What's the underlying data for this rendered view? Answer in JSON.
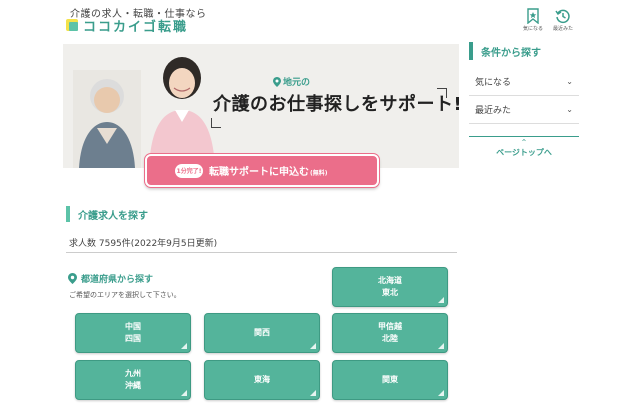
{
  "header": {
    "tagline": "介護の求人・転職・仕事なら",
    "logo_text": "ココカイゴ転職",
    "icons": [
      {
        "icon": "bookmark-star-icon",
        "label": "気になる"
      },
      {
        "icon": "history-clock-icon",
        "label": "最近みた"
      }
    ]
  },
  "hero": {
    "pin_label": "地元の",
    "title": "介護のお仕事探しをサポート!"
  },
  "cta": {
    "badge": "1分完了!",
    "label": "転職サポートに申込む",
    "note": "(無料)"
  },
  "sidebar": {
    "title": "条件から探す",
    "items": [
      {
        "label": "気になる",
        "icon": "chevron-down-icon"
      },
      {
        "label": "最近みた",
        "icon": "chevron-down-icon"
      }
    ],
    "pagetop": "ページトップへ"
  },
  "search": {
    "section_title": "介護求人を探す",
    "count_text": "求人数 7595件(2022年9月5日更新)",
    "pref_title": "都道府県から探す",
    "pref_sub": "ご希望のエリアを選択して下さい。",
    "regions": [
      {
        "line1": "北海道",
        "line2": "東北"
      },
      {
        "line1": "中国",
        "line2": "四国"
      },
      {
        "line1": "関西",
        "line2": ""
      },
      {
        "line1": "甲信越",
        "line2": "北陸"
      },
      {
        "line1": "九州",
        "line2": "沖縄"
      },
      {
        "line1": "東海",
        "line2": ""
      },
      {
        "line1": "関東",
        "line2": ""
      }
    ]
  },
  "colors": {
    "brand_green": "#3a9d8c",
    "tile_green": "#54b49b",
    "cta_pink": "#eb6e8a",
    "logo_yellow": "#f3e24a"
  }
}
